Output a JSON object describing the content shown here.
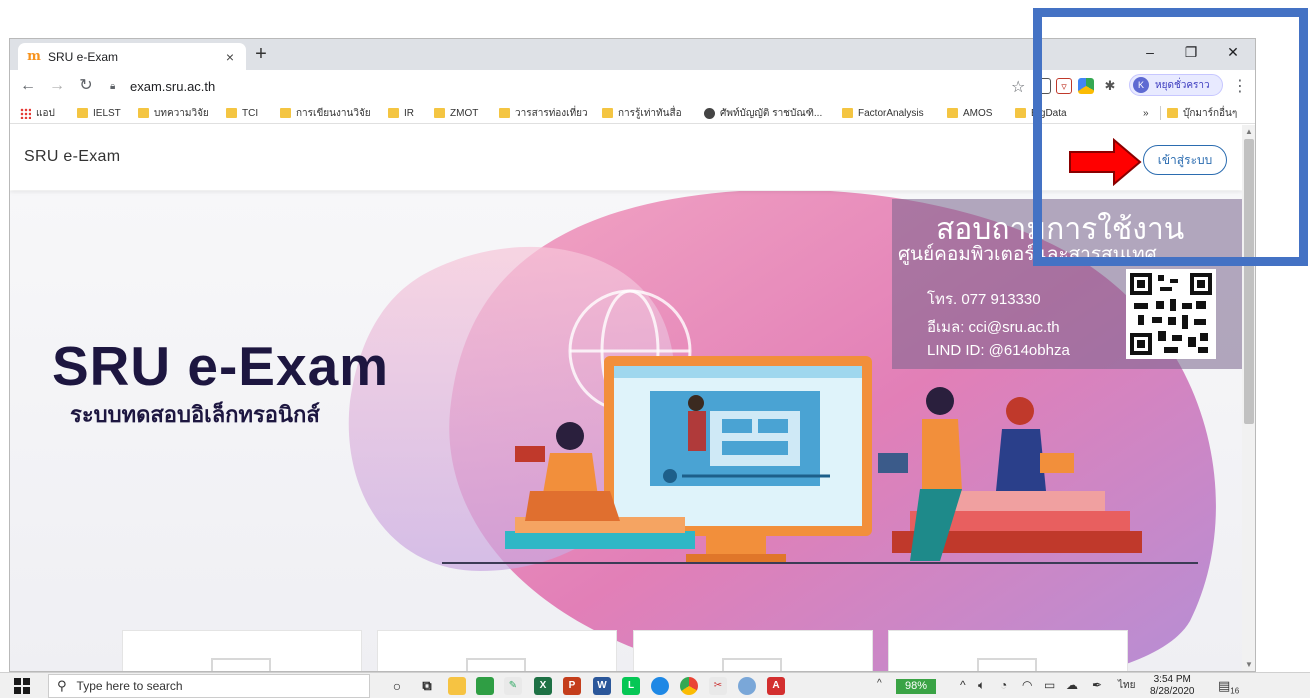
{
  "browser": {
    "tab_title": "SRU e-Exam",
    "tab_close": "×",
    "new_tab": "+",
    "url": "exam.sru.ac.th",
    "profile_initial": "K",
    "profile_name": "หยุดชั่วคราว",
    "window_controls": {
      "minimize": "–",
      "maximize": "❐",
      "close": "✕"
    }
  },
  "bookmarks": {
    "items": [
      "แอป",
      "IELST",
      "บทความวิจัย",
      "TCI",
      "การเขียนงานวิจัย",
      "IR",
      "ZMOT",
      "วารสารท่องเที่ยว",
      "การรู้เท่าทันสื่อ",
      "ศัพท์บัญญัติ ราชบัณฑิ...",
      "FactorAnalysis",
      "AMOS",
      "BigData"
    ],
    "overflow": "»",
    "other": "บุ๊กมาร์กอื่นๆ"
  },
  "page": {
    "site_title": "SRU e-Exam",
    "login_button": "เข้าสู่ระบบ",
    "hero_title": "SRU  e-Exam",
    "hero_subtitle": "ระบบทดสอบอิเล็กทรอนิกส์",
    "contact": {
      "heading": "สอบถามการใช้งาน",
      "subheading": "ศูนย์คอมพิวเตอร์และสารสนเทศ",
      "phone": "โทร. 077 913330",
      "email": "อีเมล: cci@sru.ac.th",
      "line": "LIND ID: @614obhza"
    }
  },
  "taskbar": {
    "search_placeholder": "Type here to search",
    "battery": "98%",
    "language": "ไทย",
    "time": "3:54 PM",
    "date": "8/28/2020",
    "notification_count": "16"
  },
  "colors": {
    "annotation_box": "#4472c4",
    "annotation_arrow": "#ff0000",
    "login_accent": "#2b6cb0",
    "hero_text": "#1d1640"
  }
}
